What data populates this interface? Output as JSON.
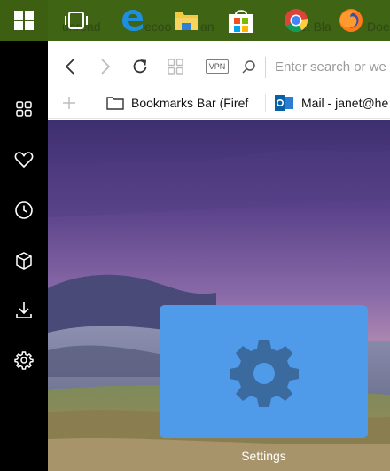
{
  "taskbar": {
    "ghost_text_1": "unread",
    "ghost_text_2": "ecoo",
    "ghost_text_3": "an",
    "ghost_text_4": "et Bla",
    "ghost_text_5": "Doe",
    "start_icon": "windows-logo-icon",
    "apps": [
      {
        "name": "task-view-icon"
      },
      {
        "name": "edge-icon"
      },
      {
        "name": "file-explorer-icon"
      },
      {
        "name": "store-icon"
      },
      {
        "name": "chrome-icon"
      },
      {
        "name": "firefox-icon"
      }
    ],
    "accent": "#3e6414"
  },
  "sidebar": {
    "items": [
      {
        "icon": "speed-dial-icon"
      },
      {
        "icon": "heart-icon"
      },
      {
        "icon": "history-icon"
      },
      {
        "icon": "box-icon"
      },
      {
        "icon": "download-icon"
      },
      {
        "icon": "settings-gear-icon"
      }
    ]
  },
  "nav": {
    "vpn_label": "VPN",
    "search_placeholder": "Enter search or we"
  },
  "bookmarks": {
    "items": [
      {
        "label": "Bookmarks Bar (Firef",
        "icon": "folder-icon"
      },
      {
        "label": "Mail - janet@he",
        "icon": "outlook-icon"
      }
    ]
  },
  "tile": {
    "label": "Settings",
    "color": "#4f9bea"
  }
}
